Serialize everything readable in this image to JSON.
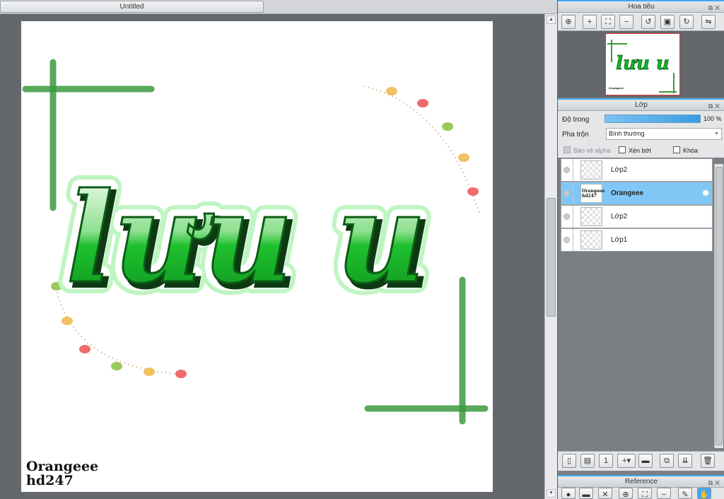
{
  "document_tab": {
    "title": "Untitled"
  },
  "canvas": {
    "artwork_text": "lưu u",
    "watermark_line1": "Orangeee",
    "watermark_line2": "hd247",
    "colors": {
      "accent_green": "#3c9a3f",
      "text_green": "#15b526",
      "outline_green": "#bff5c2"
    }
  },
  "navigator_panel": {
    "title": "Hoa tiêu",
    "tools": [
      "zoom-fit-icon",
      "zoom-in-icon",
      "fit-screen-icon",
      "zoom-out-icon",
      "rotate-left-icon",
      "actual-size-icon",
      "rotate-right-icon",
      "flip-icon"
    ]
  },
  "layer_panel": {
    "title": "Lớp",
    "opacity_label": "Độ trong",
    "opacity_value": "100 %",
    "opacity_fraction": 1.0,
    "blend_label": "Pha trộn",
    "blend_value": "Bình thường",
    "protect_alpha_label": "Bảo vệ alpha",
    "clipping_label": "Xén bớt",
    "lock_label": "Khóa",
    "layers": [
      {
        "name": "Lớp2",
        "selected": false,
        "thumb_text": ""
      },
      {
        "name": "Orangeee",
        "selected": true,
        "thumb_text": "Orangeee hd247"
      },
      {
        "name": "Lớp2",
        "selected": false,
        "thumb_text": ""
      },
      {
        "name": "Lớp1",
        "selected": false,
        "thumb_text": ""
      }
    ],
    "tools": [
      "new-layer-icon",
      "new-layer-from-file-icon",
      "new-1bit-layer-icon",
      "add-layer-menu-icon",
      "new-folder-icon",
      "duplicate-layer-icon",
      "merge-down-icon",
      "delete-layer-icon"
    ]
  },
  "reference_panel": {
    "title": "Reference"
  },
  "accent_color": "#3fa9f5"
}
